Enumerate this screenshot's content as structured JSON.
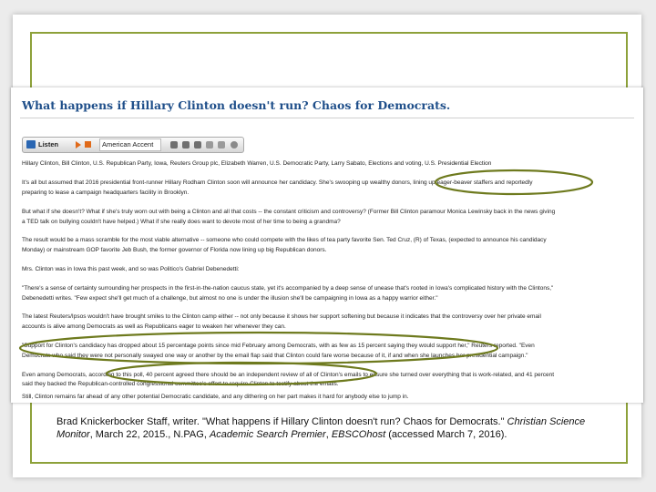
{
  "article": {
    "headline": "What happens if Hillary Clinton doesn't run? Chaos for Democrats.",
    "toolbar": {
      "listen_label": "Listen",
      "accent_label": "American Accent"
    },
    "tags": "Hillary Clinton, Bill Clinton, U.S. Republican Party, Iowa, Reuters Group plc, Elizabeth Warren, U.S. Democratic Party, Larry Sabato, Elections and voting, U.S. Presidential Election",
    "paragraphs": [
      "It's all but assumed that 2016 presidential front-runner Hillary Rodham Clinton soon will announce her candidacy. She's swooping up wealthy donors, lining up eager-beaver staffers and reportedly",
      "preparing to lease a campaign headquarters facility in Brooklyn.",
      "But what if she doesn't? What if she's truly worn out with being a Clinton and all that costs -- the constant criticism and controversy? (Former Bill Clinton paramour Monica Lewinsky back in the news giving",
      "a TED talk on bullying couldn't have helped.) What if she really does want to devote most of her time to being a grandma?",
      "The result would be a mass scramble for the most viable alternative -- someone who could compete with the likes of tea party favorite Sen. Ted Cruz, (R) of Texas, (expected to announce his candidacy",
      "Monday) or mainstream GOP favorite Jeb Bush, the former governor of Florida now lining up big Republican donors.",
      "Mrs. Clinton was in Iowa this past week, and so was Politico's Gabriel Debenedetti:",
      "\"There's a sense of certainty surrounding her prospects in the first-in-the-nation caucus state, yet it's accompanied by a deep sense of unease that's rooted in Iowa's complicated history with the Clintons,\"",
      "Debenedetti writes. \"Few expect she'll get much of a challenge, but almost no one is under the illusion she'll be campaigning in Iowa as a happy warrior either.\"",
      "The latest Reuters/Ipsos wouldn't have brought smiles to the Clinton camp either -- not only because it shows her support softening but because it indicates that the controversy over her private email",
      "accounts is alive among Democrats as well as Republicans eager to weaken her whenever they can.",
      "\"Support for Clinton's candidacy has dropped about 15 percentage points since mid February among Democrats, with as few as 15 percent saying they would support her,\" Reuters reported. \"Even",
      "Democrats who said they were not personally swayed one way or another by the email flap said that Clinton could fare worse because of it, if and when she launches her presidential campaign.\"",
      "Even among Democrats, according to this poll, 40 percent agreed there should be an independent review of all of Clinton's emails to ensure she turned over everything that is work-related, and 41 percent",
      "said they backed the Republican-controlled congressional committee's effort to require Clinton to testify about the emails.",
      "Still, Clinton remains far ahead of any other potential Democratic candidate, and any dithering on her part makes it hard for anybody else to jump in."
    ]
  },
  "citation": {
    "prefix": "Brad Knickerbocker Staff, writer. \"What happens if Hillary Clinton doesn't run? Chaos for Democrats.\" ",
    "publication": "Christian Science Monitor",
    "middle": ", March 22, 2015., N.PAG, ",
    "database": "Academic Search Premier",
    "middle2": ", ",
    "provider": "EBSCOhost",
    "suffix": " (accessed March 7, 2016)."
  },
  "colors": {
    "headline": "#1f4f8a",
    "frame_accent": "#8da13a",
    "annotation_ovals": "#6e7a1e"
  },
  "icons": [
    "speaker-icon",
    "play-icon",
    "stop-icon",
    "settings-icon",
    "download-icon",
    "help-icon",
    "close-icon"
  ]
}
